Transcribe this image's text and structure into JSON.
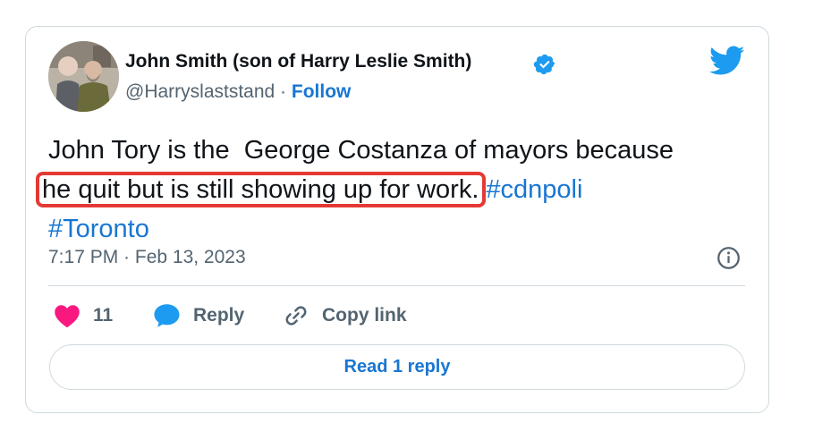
{
  "author": {
    "display_name": "John Smith (son of Harry Leslie Smith)",
    "handle": "@Harryslaststand",
    "separator": "·",
    "follow_label": "Follow"
  },
  "tweet": {
    "text_before": "John Tory is the  George Costanza of mayors because\n",
    "highlighted_text": "he quit but is still showing up for work.",
    "hashtag_1": "#cdnpoli",
    "hashtag_2": "#Toronto"
  },
  "meta": {
    "timestamp": "7:17 PM · Feb 13, 2023"
  },
  "actions": {
    "like_count": "11",
    "reply_label": "Reply",
    "copy_link_label": "Copy link"
  },
  "read_replies_label": "Read 1 reply",
  "colors": {
    "accent": "#1976d2",
    "like": "#f91880",
    "highlight_border": "#e53935",
    "secondary_text": "#536471"
  },
  "icons": [
    "avatar-photo",
    "verified-badge-icon",
    "twitter-bird-icon",
    "info-icon",
    "heart-icon",
    "reply-bubble-icon",
    "link-icon"
  ]
}
